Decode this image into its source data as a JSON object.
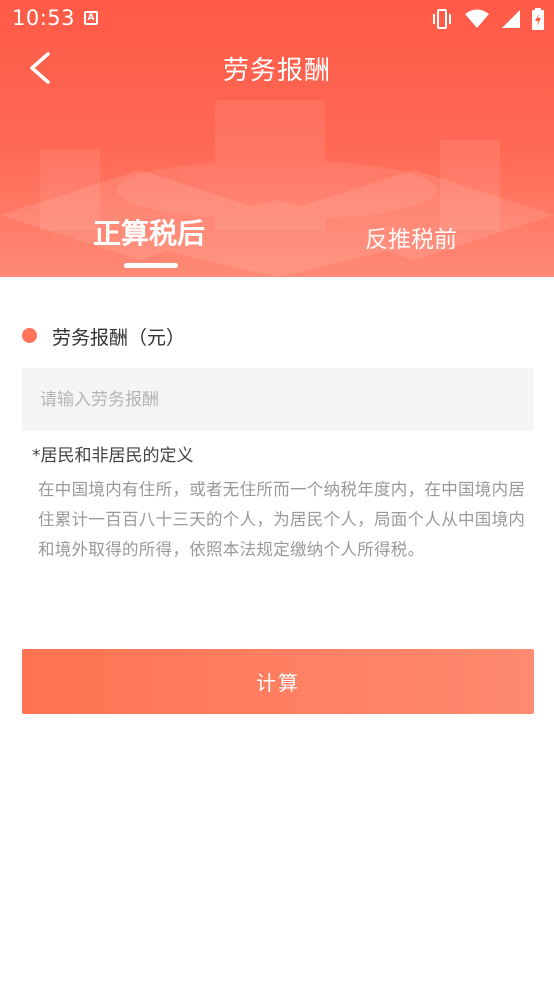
{
  "status_bar": {
    "time": "10:53",
    "notification_icon": "a-app-icon",
    "icons": [
      "vibrate-icon",
      "wifi-icon",
      "signal-icon",
      "battery-icon"
    ]
  },
  "nav": {
    "title": "劳务报酬",
    "back_icon": "chevron-left-icon"
  },
  "tabs": [
    {
      "label": "正算税后",
      "active": true
    },
    {
      "label": "反推税前",
      "active": false
    }
  ],
  "form": {
    "field_label": "劳务报酬（元）",
    "input_placeholder": "请输入劳务报酬",
    "input_value": ""
  },
  "definition": {
    "title": "*居民和非居民的定义",
    "text": "在中国境内有住所，或者无住所而一个纳税年度内，在中国境内居住累计一百百八十三天的个人，为居民个人，局面个人从中国境内和境外取得的所得，依照本法规定缴纳个人所得税。"
  },
  "actions": {
    "calculate_label": "计算"
  },
  "colors": {
    "header_top": "#ff5a47",
    "header_bottom": "#ff8a76",
    "accent": "#ff7458",
    "button_start": "#ff7352",
    "button_end": "#ff8a70"
  }
}
